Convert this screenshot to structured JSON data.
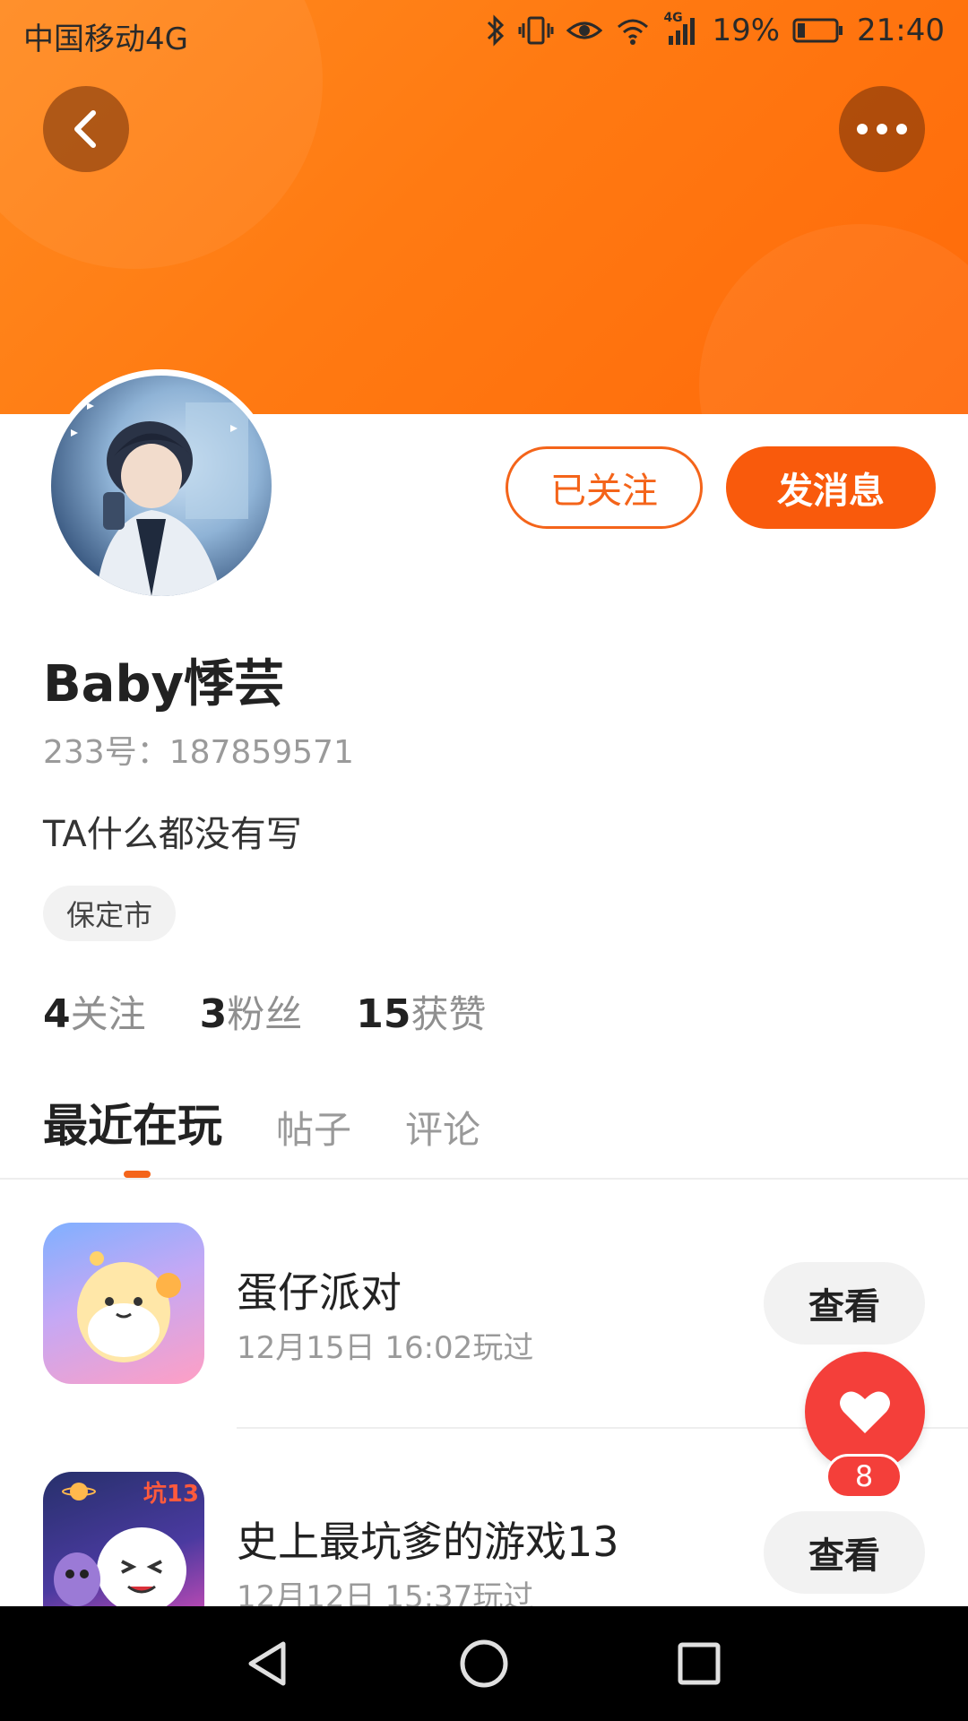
{
  "status_bar": {
    "carrier": "中国移动4G",
    "network_badge": "4G",
    "battery": "19%",
    "time": "21:40"
  },
  "header": {
    "back_icon": "chevron-left-icon",
    "more_icon": "more-dots-icon",
    "background_color": "#ff7a12"
  },
  "profile": {
    "follow_label": "已关注",
    "message_label": "发消息",
    "name": "Baby悸芸",
    "id_label": "233号：187859571",
    "bio": "TA什么都没有写",
    "city": "保定市",
    "stats": [
      {
        "num": "4",
        "label": "关注"
      },
      {
        "num": "3",
        "label": "粉丝"
      },
      {
        "num": "15",
        "label": "获赞"
      }
    ]
  },
  "tabs": [
    "最近在玩",
    "帖子",
    "评论"
  ],
  "games": [
    {
      "title": "蛋仔派对",
      "time": "12月15日 16:02玩过",
      "action": "查看"
    },
    {
      "title": "史上最坑爹的游戏13",
      "time": "12月12日 15:37玩过",
      "action": "查看"
    }
  ],
  "game_icon_badge": "坑13",
  "like": {
    "count": "8"
  },
  "accent_color": "#f4641a"
}
